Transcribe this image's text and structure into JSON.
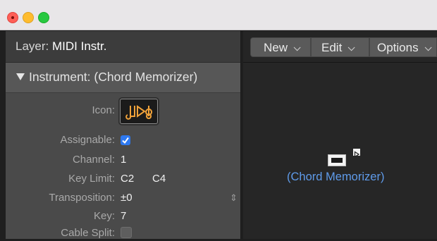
{
  "window": {
    "traffic_lights": {
      "close": "#fe5f57",
      "minimize": "#febc2e",
      "maximize": "#28c840"
    }
  },
  "inspector": {
    "layer_label": "Layer:",
    "layer_value": "MIDI Instr.",
    "instrument_header": "Instrument:  (Chord Memorizer)",
    "params": {
      "icon_label": "Icon:",
      "assignable_label": "Assignable:",
      "assignable_checked": true,
      "channel_label": "Channel:",
      "channel_value": "1",
      "key_limit_label": "Key Limit:",
      "key_limit_low": "C2",
      "key_limit_high": "C4",
      "transposition_label": "Transposition:",
      "transposition_value": "±0",
      "key_label": "Key:",
      "key_value": "7",
      "cable_split_label": "Cable Split:",
      "cable_split_checked": false
    }
  },
  "toolbar": {
    "new_label": "New",
    "edit_label": "Edit",
    "options_label": "Options"
  },
  "canvas": {
    "object_label": "(Chord Memorizer)",
    "accent_color": "#5f9bea"
  },
  "icons": [
    "chord-memorizer-icon",
    "disclosure-triangle-icon",
    "checkmark-icon",
    "stepper-icon",
    "chevron-down-icon",
    "output-port-icon"
  ]
}
